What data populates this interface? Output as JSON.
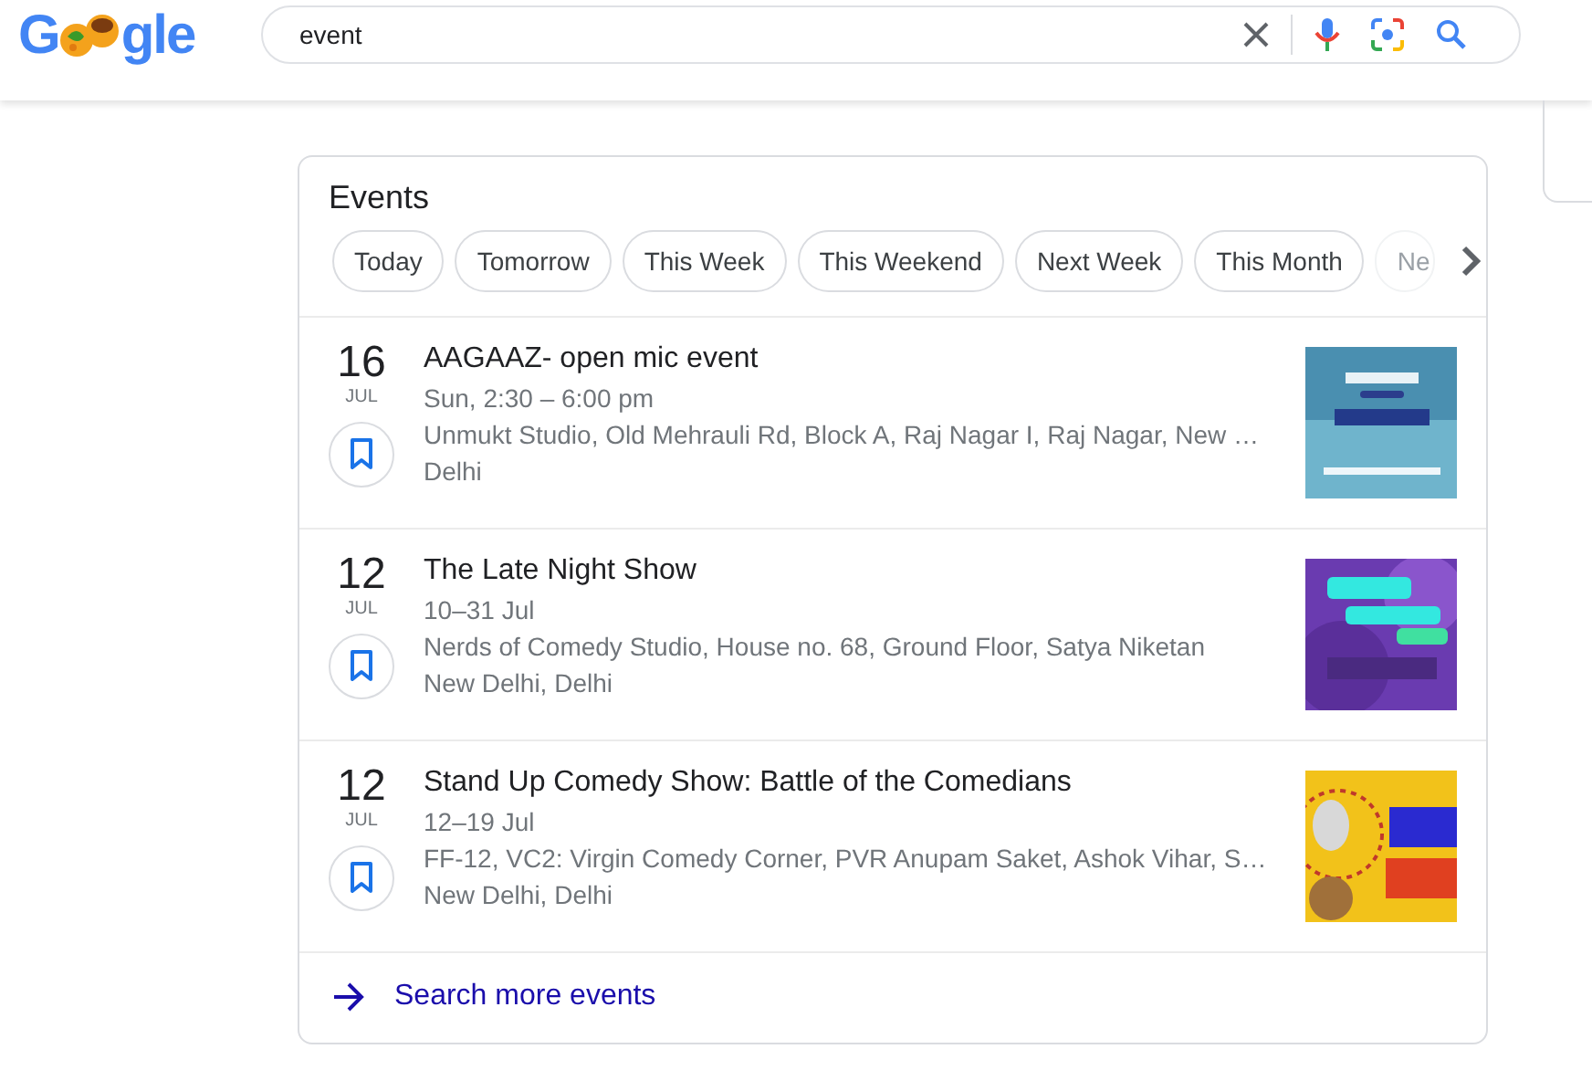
{
  "logo": {
    "before": "G",
    "after": "gle"
  },
  "search": {
    "value": "event"
  },
  "events": {
    "title": "Events",
    "chips": [
      {
        "label": "Today",
        "faded": false
      },
      {
        "label": "Tomorrow",
        "faded": false
      },
      {
        "label": "This Week",
        "faded": false
      },
      {
        "label": "This Weekend",
        "faded": false
      },
      {
        "label": "Next Week",
        "faded": false
      },
      {
        "label": "This Month",
        "faded": false
      },
      {
        "label": "Ne",
        "faded": true
      }
    ],
    "items": [
      {
        "day": "16",
        "month": "JUL",
        "title": "AAGAAZ- open mic event",
        "when": "Sun, 2:30 – 6:00 pm",
        "address": "Unmukt Studio, Old Mehrauli Rd, Block A, Raj Nagar I, Raj Nagar, New …",
        "city": "Delhi"
      },
      {
        "day": "12",
        "month": "JUL",
        "title": "The Late Night Show",
        "when": "10–31 Jul",
        "address": "Nerds of Comedy Studio, House no. 68, Ground Floor, Satya Niketan",
        "city": "New Delhi, Delhi"
      },
      {
        "day": "12",
        "month": "JUL",
        "title": "Stand Up Comedy Show: Battle of the Comedians",
        "when": "12–19 Jul",
        "address": "FF-12, VC2: Virgin Comedy Corner, PVR Anupam Saket, Ashok Vihar, S…",
        "city": "New Delhi, Delhi"
      }
    ],
    "more": "Search more events"
  }
}
